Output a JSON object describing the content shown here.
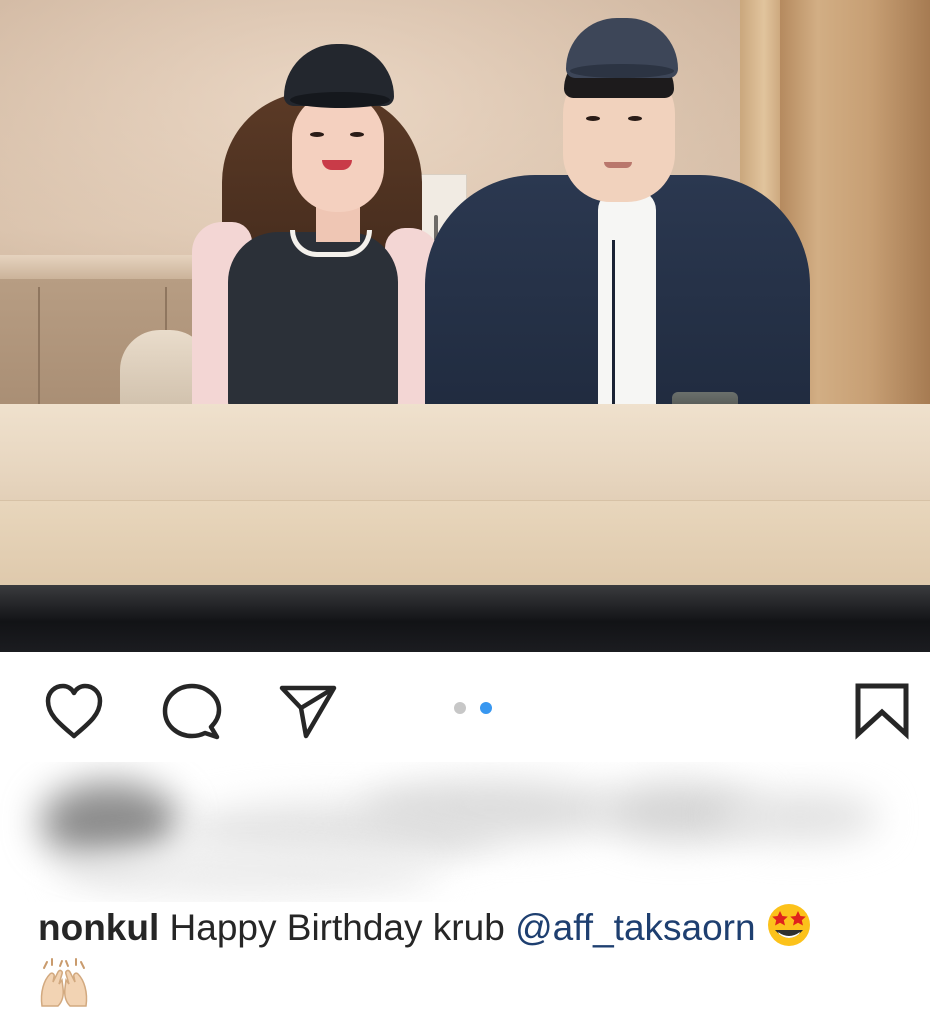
{
  "post": {
    "carousel": {
      "total": 2,
      "active_index": 1
    },
    "caption": {
      "username": "nonkul",
      "text": "Happy Birthday krub",
      "mention": "@aff_taksaorn"
    }
  },
  "icons": {
    "like": "heart-icon",
    "comment": "comment-bubble-icon",
    "share": "paper-plane-icon",
    "save": "bookmark-icon",
    "caption_emoji_1": "star-struck-emoji",
    "caption_emoji_2": "raising-hands-emoji"
  },
  "colors": {
    "carousel_active": "#3897f0",
    "carousel_inactive": "#c7c7c7",
    "mention": "#1e3f70",
    "text": "#262626"
  }
}
